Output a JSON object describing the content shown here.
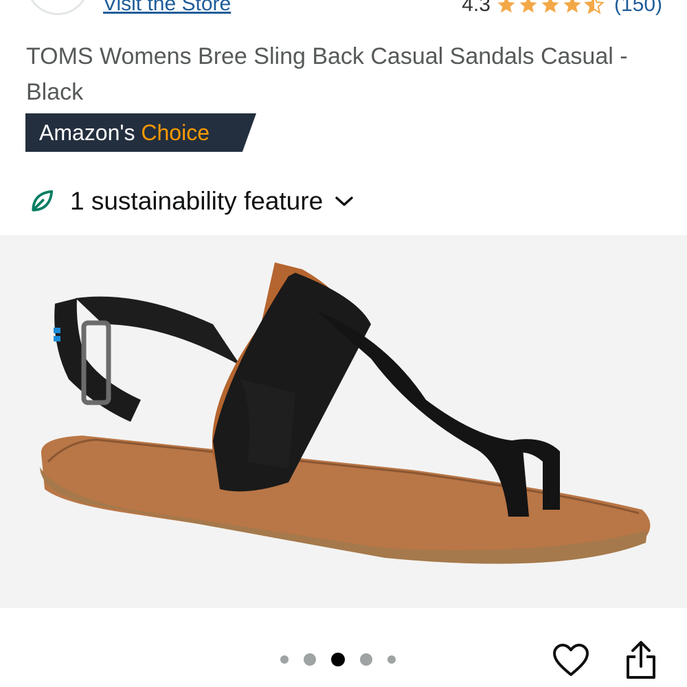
{
  "header": {
    "visit_store": "Visit the Store",
    "rating_value": "4.3",
    "rating_count": "(150)",
    "stars": 4.3,
    "star_color": "#f3a847"
  },
  "product": {
    "title": "TOMS Womens Bree Sling Back Casual Sandals Casual - Black",
    "badge_prefix": "Amazon's",
    "badge_choice": "Choice",
    "sustainability": "1 sustainability feature"
  },
  "gallery": {
    "image_index": 3,
    "image_count": 5,
    "icons": [
      "heart-icon",
      "share-icon",
      "leaf-icon",
      "chevron-down-icon"
    ]
  },
  "colors": {
    "link": "#1f5d99",
    "badge_bg": "#232f3e",
    "badge_accent": "#ff9900",
    "leaf": "#067d62"
  }
}
